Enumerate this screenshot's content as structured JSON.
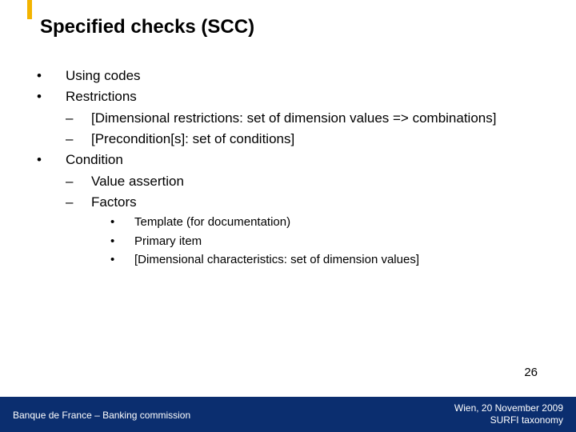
{
  "slide": {
    "title": "Specified checks (SCC)",
    "page_number": "26"
  },
  "bullets": {
    "l1": {
      "a": "Using codes",
      "b": "Restrictions",
      "c": "Condition"
    },
    "l2": {
      "b1": "[Dimensional restrictions: set of dimension values => combinations]",
      "b2": "[Precondition[s]: set of conditions]",
      "c1": "Value assertion",
      "c2": "Factors"
    },
    "l3": {
      "c2a": "Template (for documentation)",
      "c2b": "Primary item",
      "c2c": "[Dimensional characteristics: set of dimension values]"
    }
  },
  "footer": {
    "left": "Banque de France – Banking commission",
    "right_line1": "Wien, 20 November  2009",
    "right_line2": "SURFI taxonomy"
  },
  "marks": {
    "dot": "•",
    "dash": "–"
  }
}
